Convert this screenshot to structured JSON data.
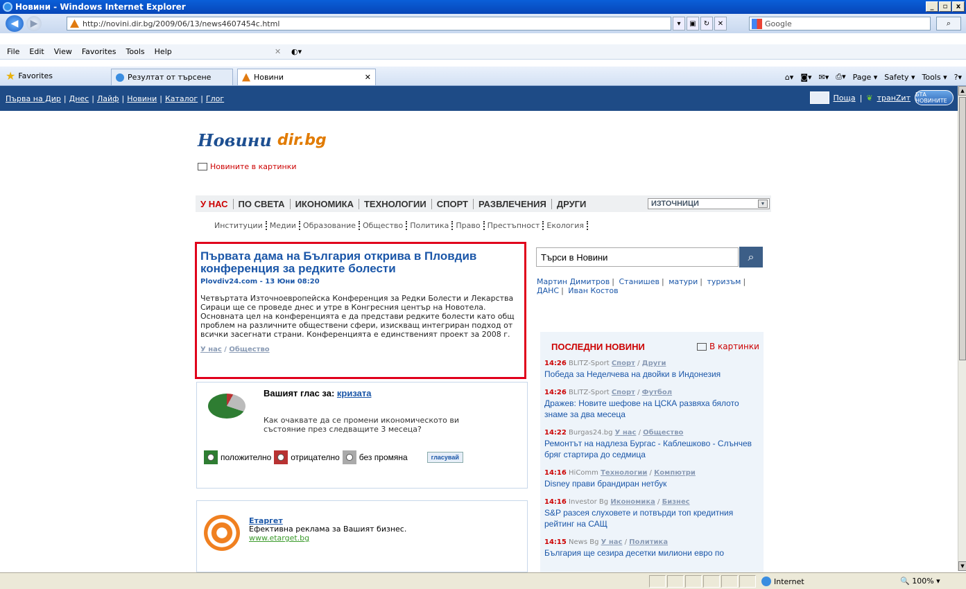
{
  "window": {
    "title": "Новини - Windows Internet Explorer"
  },
  "address": {
    "url": "http://novini.dir.bg/2009/06/13/news4607454c.html",
    "search_placeholder": "Google"
  },
  "menu": [
    "File",
    "Edit",
    "View",
    "Favorites",
    "Tools",
    "Help"
  ],
  "tabs": {
    "favorites": "Favorites",
    "items": [
      {
        "label": "Резултат от търсене"
      },
      {
        "label": "Новини"
      }
    ]
  },
  "commandbar": {
    "page": "Page ▾",
    "safety": "Safety ▾",
    "tools": "Tools ▾"
  },
  "topnav": {
    "links": [
      "Първа на Дир",
      "Днес",
      "Лайф",
      "Новини",
      "Каталог",
      "Глог"
    ],
    "mail": "Поща",
    "tranzit": "транZит",
    "bta": "БТА НОВИНИТЕ"
  },
  "logo": {
    "text": "Новини",
    "dir": "dir.bg"
  },
  "pics_link": "Новините в картинки",
  "categories": [
    "У НАС",
    "ПО СВЕТА",
    "ИКОНОМИКА",
    "ТЕХНОЛОГИИ",
    "СПОРТ",
    "РАЗВЛЕЧЕНИЯ",
    "ДРУГИ"
  ],
  "sources_select": "ИЗТОЧНИЦИ",
  "subcategories": [
    "Институции",
    "Медии",
    "Образование",
    "Общество",
    "Политика",
    "Право",
    "Престъпност",
    "Екология"
  ],
  "article": {
    "title": "Първата дама на България открива в Пловдив конференция за редките болести",
    "meta": "Plovdiv24.com - 13 Юни 08:20",
    "body": "Четвъртата Източноевропейска Конференция за Редки Болести и Лекарства Сираци ще се проведе днес и утре в Конгресния център на Новотела. Основната цел на конференцията е да представи редките болести като общ проблем на различните обществени сфери, изискващ интегриран подход от всички засегнати страни. Конференцията е единственият проект за 2008 г.",
    "tag1": "У нас",
    "tag2": "Общество"
  },
  "poll": {
    "title_prefix": "Вашият глас за:",
    "topic": "кризата",
    "question": "Как очаквате да се промени икономическото ви състояние през следващите 3 месеца?",
    "options": [
      "положително",
      "отрицателно",
      "без промяна"
    ],
    "vote": "гласувай"
  },
  "ad": {
    "title": "Етаргет",
    "desc": "Ефективна реклама за Вашият бизнес.",
    "url": "www.etarget.bg"
  },
  "search": {
    "placeholder": "Търси в Новини"
  },
  "hot_tags": [
    "Мартин Димитров",
    "Станишев",
    "матури",
    "туризъм",
    "ДАНС",
    "Иван Костов"
  ],
  "latest": {
    "heading": "ПОСЛЕДНИ НОВИНИ",
    "pics": "В картинки",
    "items": [
      {
        "time": "14:26",
        "source": "BLITZ-Sport",
        "cat1": "Спорт",
        "cat2": "Други",
        "headline": "Победа за Неделчева на двойки в Индонезия"
      },
      {
        "time": "14:26",
        "source": "BLITZ-Sport",
        "cat1": "Спорт",
        "cat2": "Футбол",
        "headline": "Дражев: Новите шефове на ЦСКА развяха бялото знаме за два месеца"
      },
      {
        "time": "14:22",
        "source": "Burgas24.bg",
        "cat1": "У нас",
        "cat2": "Общество",
        "headline": "Ремонтът на надлеза Бургас - Каблешково - Слънчев бряг стартира до седмица"
      },
      {
        "time": "14:16",
        "source": "HiComm",
        "cat1": "Технологии",
        "cat2": "Компютри",
        "headline": "Disney прави брандиран нетбук"
      },
      {
        "time": "14:16",
        "source": "Investor Bg",
        "cat1": "Икономика",
        "cat2": "Бизнес",
        "headline": "S&P разсея слуховете и потвърди топ кредитния рейтинг на САЩ"
      },
      {
        "time": "14:15",
        "source": "News Bg",
        "cat1": "У нас",
        "cat2": "Политика",
        "headline": "България ще сезира десетки милиони евро по"
      }
    ]
  },
  "status": {
    "zone": "Internet",
    "zoom": "100%"
  }
}
